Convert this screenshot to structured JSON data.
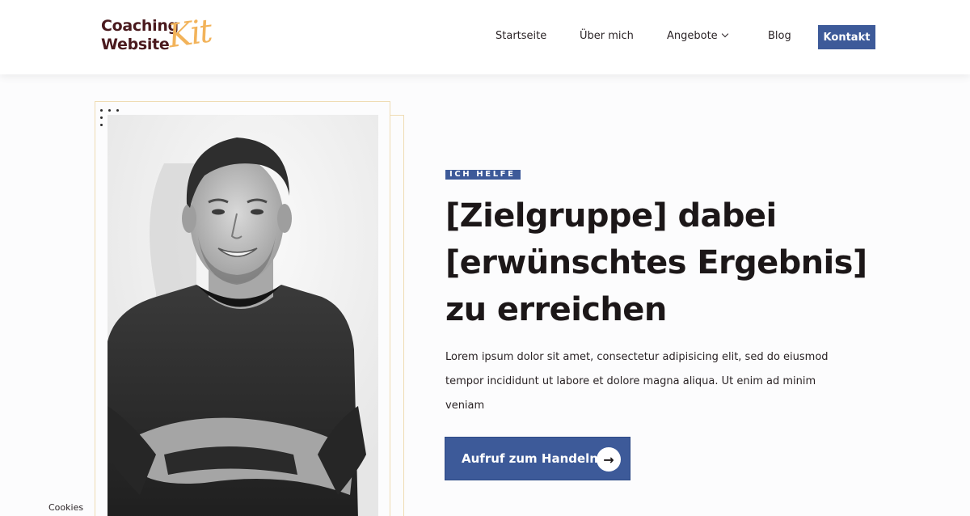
{
  "logo": {
    "line1": "Coaching",
    "line2": "Website",
    "script": "Kit"
  },
  "nav": {
    "items": [
      {
        "label": "Startseite"
      },
      {
        "label": "Über mich"
      },
      {
        "label": "Angebote"
      },
      {
        "label": "Blog"
      }
    ],
    "cta_label": "Kontakt"
  },
  "hero": {
    "badge": "ICH HELFE",
    "headline": [
      "[Zielgruppe] dabei",
      "[erwünschtes Ergebnis]",
      "zu erreichen"
    ],
    "body": [
      "Lorem ipsum dolor sit amet, consectetur adipisicing elit, sed do eiusmod",
      "tempor incididunt ut labore et dolore magna aliqua. Ut enim ad minim",
      "veniam"
    ],
    "cta_label": "Aufruf zum Handeln",
    "cta_icon": "→"
  },
  "footer": {
    "cookies_label": "Cookies"
  },
  "colors": {
    "accent": "#3d5a99",
    "logo_dark": "#4a1a1e",
    "logo_script": "#f2b35a",
    "frame": "#efdcb4"
  },
  "icons": {
    "dropdown": "chevron-down-icon",
    "cta": "arrow-right-icon"
  }
}
